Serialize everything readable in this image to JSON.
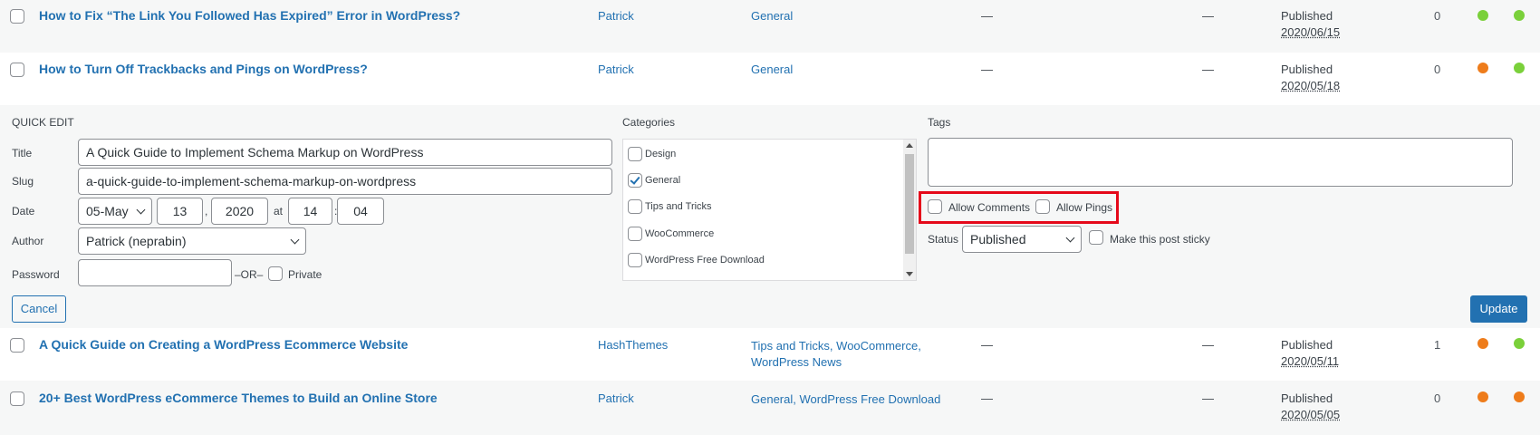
{
  "posts_top": [
    {
      "title": "How to Fix “The Link You Followed Has Expired” Error in WordPress?",
      "author": "Patrick",
      "categories": "General",
      "tags": "—",
      "comments_col": "—",
      "status": "Published",
      "date": "2020/06/15",
      "count": "0",
      "seo_color": "#7ad03a",
      "read_color": "#7ad03a"
    },
    {
      "title": "How to Turn Off Trackbacks and Pings on WordPress?",
      "author": "Patrick",
      "categories": "General",
      "tags": "—",
      "comments_col": "—",
      "status": "Published",
      "date": "2020/05/18",
      "count": "0",
      "seo_color": "#ee7c1b",
      "read_color": "#7ad03a"
    }
  ],
  "quick_edit": {
    "heading": "QUICK EDIT",
    "title_label": "Title",
    "title_value": "A Quick Guide to Implement Schema Markup on WordPress",
    "slug_label": "Slug",
    "slug_value": "a-quick-guide-to-implement-schema-markup-on-wordpress",
    "date_label": "Date",
    "month": "05-May",
    "day": "13",
    "year": "2020",
    "at": "at",
    "hour": "14",
    "minute": "04",
    "comma": ",",
    "colon": ":",
    "author_label": "Author",
    "author_value": "Patrick (neprabin)",
    "password_label": "Password",
    "password_value": "",
    "or_text": "–OR–",
    "private_label": "Private",
    "categories_label": "Categories",
    "categories": [
      {
        "label": "Design",
        "checked": false
      },
      {
        "label": "General",
        "checked": true
      },
      {
        "label": "Tips and Tricks",
        "checked": false
      },
      {
        "label": "WooCommerce",
        "checked": false
      },
      {
        "label": "WordPress Free Download",
        "checked": false
      }
    ],
    "tags_label": "Tags",
    "tags_value": "",
    "allow_comments": "Allow Comments",
    "allow_pings": "Allow Pings",
    "status_label": "Status",
    "status_value": "Published",
    "sticky_label": "Make this post sticky",
    "cancel": "Cancel",
    "update": "Update"
  },
  "posts_bottom": [
    {
      "title": "A Quick Guide on Creating a WordPress Ecommerce Website",
      "author": "HashThemes",
      "categories_line1": "Tips and Tricks, WooCommerce,",
      "categories_line2": "WordPress News",
      "tags": "—",
      "comments_col": "—",
      "status": "Published",
      "date": "2020/05/11",
      "count": "1",
      "seo_color": "#ee7c1b",
      "read_color": "#7ad03a"
    },
    {
      "title": "20+ Best WordPress eCommerce Themes to Build an Online Store",
      "author": "Patrick",
      "categories_line1": "General, WordPress Free Download",
      "categories_line2": "",
      "tags": "—",
      "comments_col": "—",
      "status": "Published",
      "date": "2020/05/05",
      "count": "0",
      "seo_color": "#ee7c1b",
      "read_color": "#ee7c1b"
    }
  ]
}
